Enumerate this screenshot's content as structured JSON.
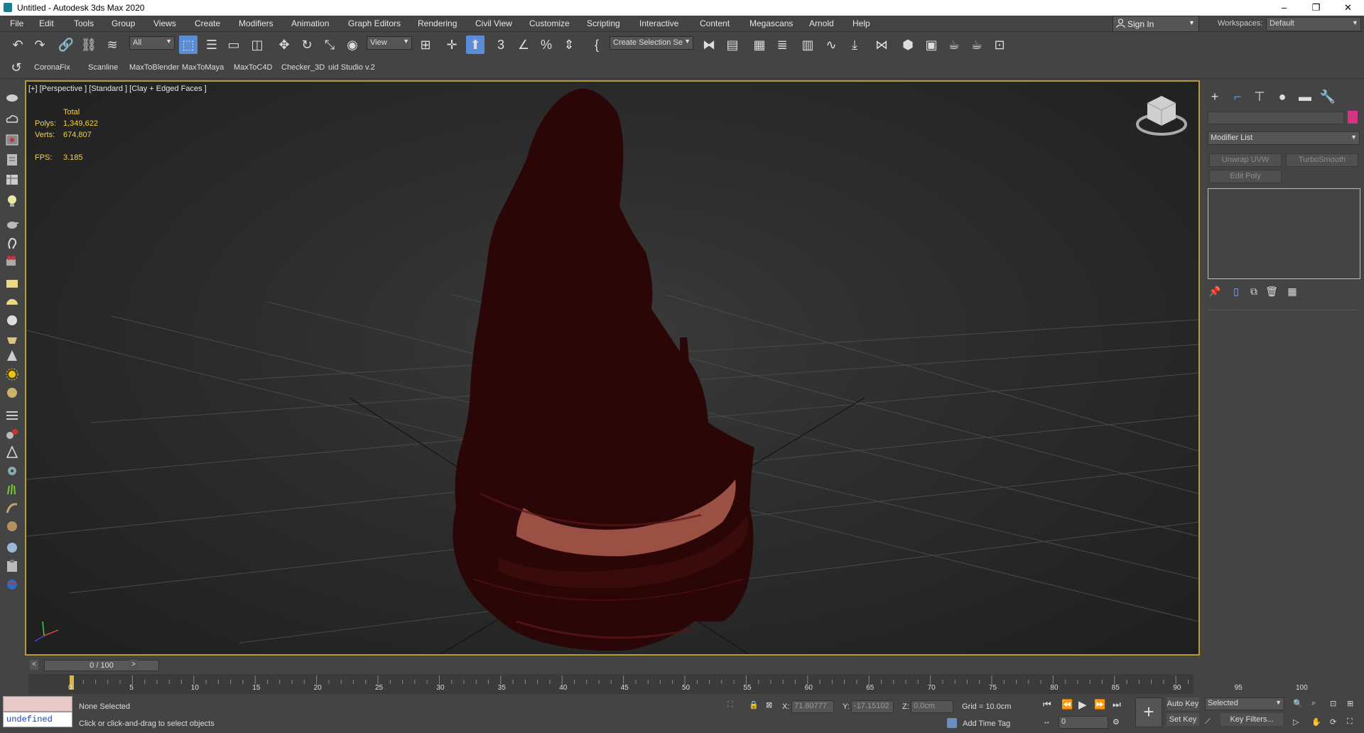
{
  "window": {
    "title": "Untitled - Autodesk 3ds Max 2020",
    "minimize": "–",
    "maximize": "❐",
    "close": "✕"
  },
  "menu": [
    "File",
    "Edit",
    "Tools",
    "Group",
    "Views",
    "Create",
    "Modifiers",
    "Animation",
    "Graph Editors",
    "Rendering",
    "Civil View",
    "Customize",
    "Scripting",
    "Interactive",
    "Content",
    "Megascans",
    "Arnold",
    "Help"
  ],
  "account": {
    "sign_in": "Sign In",
    "workspaces_label": "Workspaces:",
    "workspace": "Default"
  },
  "toolbar": {
    "selection_filter": "All",
    "reference_coord": "View",
    "named_selection_placeholder": "Create Selection Se"
  },
  "shelf": [
    "CoronaFix",
    "Scanline",
    "MaxToBlender",
    "MaxToMaya",
    "MaxToC4D",
    "Checker_3D",
    "uid Studio v.2"
  ],
  "viewport": {
    "label": "[+] [Perspective ] [Standard ] [Clay + Edged Faces ]",
    "stats": {
      "total_label": "Total",
      "polys_label": "Polys:",
      "polys": "1,349,622",
      "verts_label": "Verts:",
      "verts": "674,807",
      "fps_label": "FPS:",
      "fps": "3.185"
    },
    "model_color": "#2a0606",
    "highlight_color": "#c26a5a"
  },
  "command_panel": {
    "modifier_list": "Modifier List",
    "buttons": [
      "Unwrap UVW",
      "TurboSmooth",
      "Edit Poly"
    ],
    "color_swatch": "#d63384"
  },
  "timeline": {
    "frame_display": "0 / 100",
    "prev": "<",
    "next": ">",
    "ticks": [
      "0",
      "5",
      "10",
      "15",
      "20",
      "25",
      "30",
      "35",
      "40",
      "45",
      "50",
      "55",
      "60",
      "65",
      "70",
      "75",
      "80",
      "85",
      "90",
      "95",
      "100"
    ]
  },
  "status": {
    "selection": "None Selected",
    "prompt": "Click or click-and-drag to select objects",
    "maxscript": "undefined",
    "x_label": "X:",
    "x_value": "71.80777",
    "y_label": "Y:",
    "y_value": "-17.15102",
    "z_label": "Z:",
    "z_value": "0.0cm",
    "grid": "Grid = 10.0cm",
    "add_time_tag": "Add Time Tag",
    "auto_key": "Auto Key",
    "set_key": "Set Key",
    "key_mode": "Selected",
    "key_filters": "Key Filters...",
    "current_frame": "0"
  }
}
